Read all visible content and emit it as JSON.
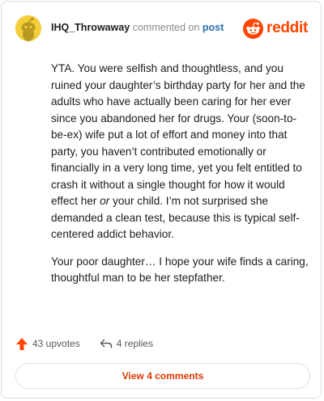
{
  "header": {
    "username": "IHQ_Throwaway",
    "verb": "commented on",
    "link": "post",
    "brand": "reddit"
  },
  "comment": {
    "para1_a": "YTA. You were selfish and thoughtless, and you ruined your daughter’s birthday party for her and the adults who have actually been caring for her ever since you abandoned her for drugs. Your (soon-to-be-ex) wife put a lot of effort and money into that party, you haven’t contributed emotionally or financially in a very long time, yet you felt entitled to crash it without a single thought for how it would effect her ",
    "para1_em": "or",
    "para1_b": " your child. I’m not surprised she demanded a clean test, because this is typical self-centered addict behavior.",
    "para2": "Your poor daughter… I hope your wife finds a caring, thoughtful man to be her stepfather."
  },
  "footer": {
    "upvotes": "43 upvotes",
    "replies": "4 replies",
    "view_comments": "View 4 comments"
  },
  "colors": {
    "accent": "#ff4500",
    "link": "#2a6fb0",
    "button_text": "#d93a00",
    "avatar_bg": "#f3cd3a"
  },
  "icons": [
    "snoo-avatar-icon",
    "reddit-logo-icon",
    "upvote-arrow-icon",
    "reply-arrow-icon"
  ]
}
